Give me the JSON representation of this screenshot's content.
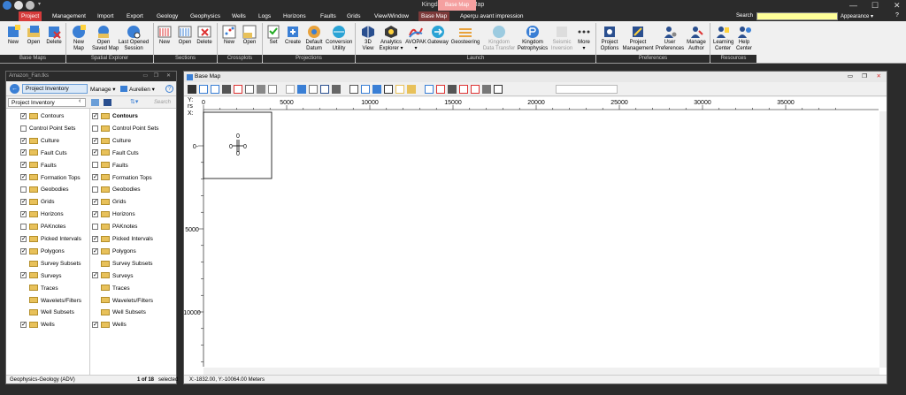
{
  "window": {
    "title": "Kingdom® - Base Map",
    "context_tab": "Base Map",
    "min": "—",
    "max": "☐",
    "close": "✕"
  },
  "menu": {
    "tabs": [
      "Project",
      "Management",
      "Import",
      "Export",
      "Geology",
      "Geophysics",
      "Wells",
      "Logs",
      "Horizons",
      "Faults",
      "Grids",
      "View/Window",
      "Base Map",
      "Aperçu avant impression"
    ],
    "search_label": "Search",
    "search_value": "",
    "appearance": "Appearance ▾"
  },
  "ribbon": {
    "groups": {
      "base_maps": "Base Maps",
      "spatial_explorer": "Spatial Explorer",
      "sections": "Sections",
      "crossplots": "Crossplots",
      "projections": "Projections",
      "launch": "Launch",
      "preferences": "Preferences",
      "resources": "Resources"
    },
    "buttons": {
      "bm_new": "New",
      "bm_open": "Open",
      "bm_delete": "Delete",
      "se_new_map": "New\nMap",
      "se_open_saved": "Open\nSaved Map",
      "se_last_opened": "Last Opened\nSession",
      "sec_new": "New",
      "sec_open": "Open",
      "sec_delete": "Delete",
      "cp_new": "New",
      "cp_open": "Open",
      "pj_set": "Set",
      "pj_create": "Create",
      "pj_default": "Default\nDatum",
      "pj_conv": "Conversion\nUtility",
      "l_3d": "3D\nView",
      "l_analytics": "Analytics\nExplorer ▾",
      "l_avopak": "AVOPAK\n▾",
      "l_gateway": "Gateway",
      "l_geosteer": "Geosteering",
      "l_kdt": "Kingdom\nData Transfer",
      "l_petro": "Kingdom\nPetrophysics",
      "l_seis": "Seismic\nInversion",
      "l_more": "More\n▾",
      "p_options": "Project\nOptions",
      "p_mgmt": "Project\nManagement",
      "p_userprefs": "User\nPreferences",
      "p_manage_author": "Manage\nAuthor",
      "r_learning": "Learning\nCenter",
      "r_help": "Help\nCenter"
    }
  },
  "left_panel": {
    "title": "Amazon_Fan.tks",
    "inventory_button": "Project Inventory",
    "manage": "Manage ▾",
    "user": "Aurelien ▾",
    "dropdown": "Project Inventory",
    "search_placeholder": "Search Proj...",
    "col1": [
      {
        "label": "Contours",
        "checked": true
      },
      {
        "label": "Control Point Sets",
        "checked": false,
        "nofolder": true
      },
      {
        "label": "Culture",
        "checked": true
      },
      {
        "label": "Fault Cuts",
        "checked": true
      },
      {
        "label": "Faults",
        "checked": true
      },
      {
        "label": "Formation Tops",
        "checked": true
      },
      {
        "label": "Geobodies",
        "checked": false
      },
      {
        "label": "Grids",
        "checked": true
      },
      {
        "label": "Horizons",
        "checked": true
      },
      {
        "label": "PAKnotes",
        "checked": false
      },
      {
        "label": "Picked Intervals",
        "checked": true
      },
      {
        "label": "Polygons",
        "checked": true
      },
      {
        "label": "Survey Subsets",
        "checked": null
      },
      {
        "label": "Surveys",
        "checked": true
      },
      {
        "label": "Traces",
        "checked": null
      },
      {
        "label": "Wavelets/Filters",
        "checked": null
      },
      {
        "label": "Well Subsets",
        "checked": null
      },
      {
        "label": "Wells",
        "checked": true
      }
    ],
    "col2": [
      {
        "label": "Contours",
        "checked": true,
        "bold": true
      },
      {
        "label": "Control Point Sets",
        "checked": false
      },
      {
        "label": "Culture",
        "checked": true
      },
      {
        "label": "Fault Cuts",
        "checked": true
      },
      {
        "label": "Faults",
        "checked": false
      },
      {
        "label": "Formation Tops",
        "checked": true
      },
      {
        "label": "Geobodies",
        "checked": false
      },
      {
        "label": "Grids",
        "checked": true
      },
      {
        "label": "Horizons",
        "checked": true
      },
      {
        "label": "PAKnotes",
        "checked": false
      },
      {
        "label": "Picked Intervals",
        "checked": true
      },
      {
        "label": "Polygons",
        "checked": true
      },
      {
        "label": "Survey Subsets",
        "checked": null
      },
      {
        "label": "Surveys",
        "checked": true
      },
      {
        "label": "Traces",
        "checked": null
      },
      {
        "label": "Wavelets/Filters",
        "checked": null
      },
      {
        "label": "Well Subsets",
        "checked": null
      },
      {
        "label": "Wells",
        "checked": true
      }
    ],
    "status_left": "Geophysics-Geology (ADV)",
    "status_right_count": "1 of 18",
    "status_right_suffix": "selected"
  },
  "map_window": {
    "title": "Base Map",
    "x_axis_label": "X:",
    "y_axis_label": "Y:",
    "y_axis_unit": "rs",
    "x_ticks": [
      "0",
      "5000",
      "10000",
      "15000",
      "20000",
      "25000",
      "30000",
      "35000"
    ],
    "y_ticks": [
      "0-",
      "5000",
      "10000"
    ],
    "survey_labels": [
      "0",
      "0",
      "0",
      "0"
    ],
    "status": "X:-1832.00,   Y:-10064.00 Meters"
  }
}
